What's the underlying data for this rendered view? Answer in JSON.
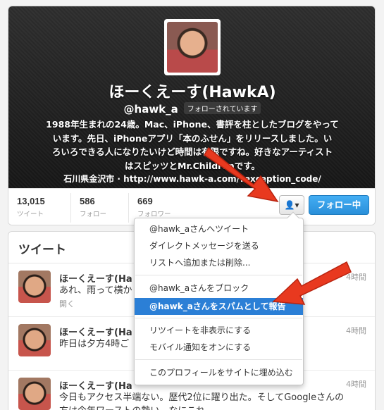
{
  "profile": {
    "name": "ほーくえーす(HawkA)",
    "handle": "@hawk_a",
    "follows_you_badge": "フォローされています",
    "bio_lines": [
      "1988年生まれの24歳。Mac、iPhone、書評を柱としたブログをやって",
      "います。先日、iPhoneアプリ「本のふせん」をリリースしました。い",
      "ろいろできる人になりたいけど時間は有限ですね。好きなアーティスト",
      "はスピッツとMr.Childrenです。"
    ],
    "location_line": "石川県金沢市 · http://www.hawk-a.com/?exception_code/"
  },
  "stats": [
    {
      "value": "13,015",
      "label": "ツイート"
    },
    {
      "value": "586",
      "label": "フォロー"
    },
    {
      "value": "669",
      "label": "フォロワー"
    }
  ],
  "buttons": {
    "user_menu_icon": "person-dropdown-icon",
    "user_menu_glyph": "👤▾",
    "follow_label": "フォロー中"
  },
  "tweets_section": {
    "title": "ツイート",
    "tweets": [
      {
        "name": "ほーくえーす(Ha",
        "text": "あれ、雨って横か",
        "time": "4時間",
        "open": "開く"
      },
      {
        "name": "ほーくえーす(Ha",
        "text": "昨日は夕方4時ご",
        "time": "4時間",
        "open": ""
      },
      {
        "name": "ほーくえーす(Ha",
        "text": "今日もアクセス半端ない。歴代2位に躍り出た。そしてGoogleさんの",
        "text2": "方は今年ワーストの勢い。なにこれ。",
        "time": "4時間",
        "open": ""
      }
    ]
  },
  "dropdown": {
    "items": [
      "@hawk_aさんへツイート",
      "ダイレクトメッセージを送る",
      "リストへ追加または削除...",
      "@hawk_aさんをブロック",
      "@hawk_aさんをスパムとして報告",
      "リツイートを非表示にする",
      "モバイル通知をオンにする",
      "このプロフィールをサイトに埋め込む"
    ],
    "highlighted_index": 4
  },
  "colors": {
    "header_bg": "#1e1e1e",
    "follow_button": "#3399e6",
    "menu_highlight": "#2b7fd6",
    "arrow": "#e8391f"
  }
}
